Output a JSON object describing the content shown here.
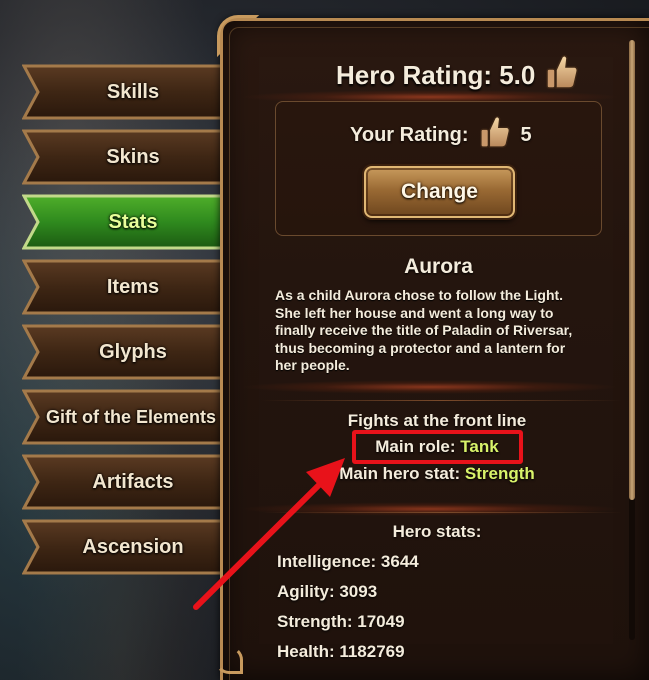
{
  "tabs": [
    {
      "label": "Skills",
      "active": false
    },
    {
      "label": "Skins",
      "active": false
    },
    {
      "label": "Stats",
      "active": true
    },
    {
      "label": "Items",
      "active": false
    },
    {
      "label": "Glyphs",
      "active": false
    },
    {
      "label": "Gift of the Elements",
      "active": false
    },
    {
      "label": "Artifacts",
      "active": false
    },
    {
      "label": "Ascension",
      "active": false
    }
  ],
  "rating": {
    "title": "Hero Rating: 5.0",
    "your_rating_label": "Your Rating:",
    "your_rating_value": "5",
    "change_label": "Change"
  },
  "hero": {
    "name": "Aurora",
    "description_lines": [
      "As a child Aurora chose to follow the Light.",
      "She left her house and went a long way to",
      "finally receive the title of Paladin of Riversar,",
      "thus becoming a protector and a lantern for",
      "her people."
    ],
    "position": "Fights at the front line",
    "main_role_label": "Main role:",
    "main_role_value": "Tank",
    "main_stat_label": "Main hero stat:",
    "main_stat_value": "Strength"
  },
  "stats": {
    "heading": "Hero stats:",
    "intelligence": "Intelligence: 3644",
    "agility": "Agility: 3093",
    "strength": "Strength: 17049",
    "health": "Health: 1182769"
  },
  "colors": {
    "accent_gold": "#b88a52",
    "active_tab_green": "#2f8a1e",
    "highlight_text": "#d8f26a",
    "annotation_red": "#e8121a"
  },
  "icons": [
    "thumbs-up-icon",
    "annotation-arrow"
  ]
}
